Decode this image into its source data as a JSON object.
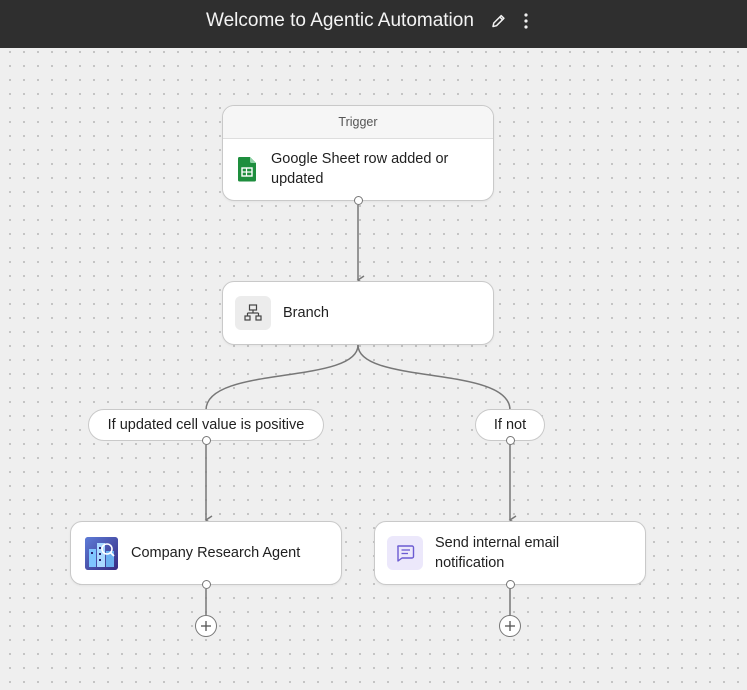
{
  "header": {
    "title": "Welcome to Agentic Automation",
    "edit_icon": "pencil-icon",
    "more_icon": "vertical-ellipsis-icon"
  },
  "trigger": {
    "header_label": "Trigger",
    "label": "Google Sheet row added or updated",
    "icon": "google-sheets-icon"
  },
  "branch": {
    "label": "Branch",
    "icon": "branch-icon"
  },
  "conditions": {
    "left": "If updated cell value is positive",
    "right": "If not"
  },
  "actions": {
    "left": {
      "label": "Company Research Agent",
      "icon": "company-research-agent-icon"
    },
    "right": {
      "label": "Send internal email notification",
      "icon": "message-icon"
    }
  },
  "colors": {
    "topbar": "#2f2f2f",
    "canvas": "#efefef",
    "connector": "#777777",
    "sheets_green": "#1e8e3e",
    "message_icon_bg": "#ece8fb",
    "message_icon_fg": "#6b5bd2"
  }
}
